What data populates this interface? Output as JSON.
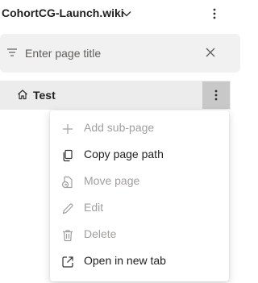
{
  "header": {
    "wiki_name": "CohortCG-Launch.wiki",
    "dropdown_icon": "chevron-down-icon",
    "more_icon": "more-vertical-icon"
  },
  "filter": {
    "placeholder": "Enter page title",
    "value": "",
    "filter_icon": "filter-icon",
    "clear_icon": "close-icon"
  },
  "tree": {
    "pages": [
      {
        "name": "Test",
        "icon": "home-icon",
        "selected": true
      }
    ]
  },
  "context_menu": {
    "items": [
      {
        "label": "Add sub-page",
        "icon": "plus-icon",
        "enabled": false
      },
      {
        "label": "Copy page path",
        "icon": "copy-icon",
        "enabled": true
      },
      {
        "label": "Move page",
        "icon": "move-icon",
        "enabled": false
      },
      {
        "label": "Edit",
        "icon": "pencil-icon",
        "enabled": false
      },
      {
        "label": "Delete",
        "icon": "trash-icon",
        "enabled": false
      },
      {
        "label": "Open in new tab",
        "icon": "open-new-tab-icon",
        "enabled": true
      }
    ]
  },
  "colors": {
    "text": "#201f1e",
    "disabled_text": "#a19f9d",
    "filter_bg": "#f1f1f1",
    "selected_row_bg": "#ececec",
    "more_button_bg": "#c8c8c8"
  }
}
